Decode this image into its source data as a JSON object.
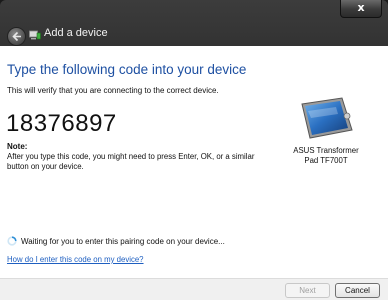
{
  "window": {
    "title": "Add a device",
    "close_label": "x"
  },
  "content": {
    "heading": "Type the following code into your device",
    "subtitle": "This will verify that you are connecting to the correct device.",
    "code": "18376897",
    "note_label": "Note:",
    "note_text": "After you type this code, you might need to press Enter, OK, or a similar button on your device.",
    "device_name": "ASUS Transformer Pad TF700T",
    "status_text": "Waiting for you to enter this pairing code on your device...",
    "help_link": "How do I enter this code on my device?"
  },
  "footer": {
    "next_label": "Next",
    "cancel_label": "Cancel"
  }
}
